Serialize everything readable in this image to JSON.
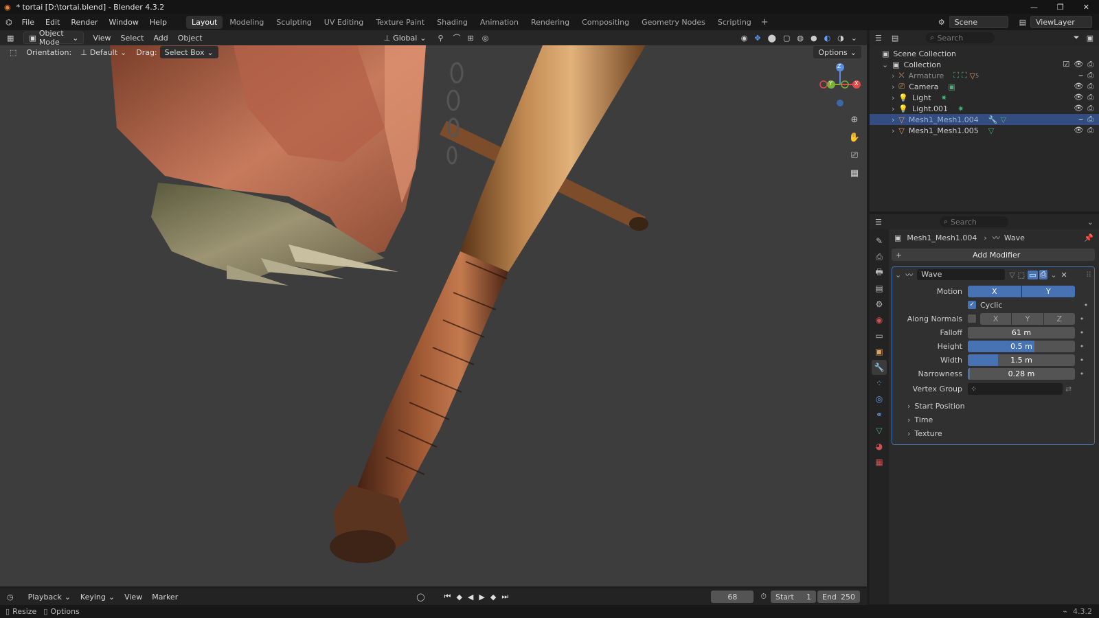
{
  "window": {
    "title": "* tortai [D:\\tortai.blend] - Blender 4.3.2",
    "min_icon": "minimize-icon",
    "max_icon": "maximize-icon",
    "close_icon": "close-icon"
  },
  "menu": [
    "File",
    "Edit",
    "Render",
    "Window",
    "Help"
  ],
  "workspaces": [
    "Layout",
    "Modeling",
    "Sculpting",
    "UV Editing",
    "Texture Paint",
    "Shading",
    "Animation",
    "Rendering",
    "Compositing",
    "Geometry Nodes",
    "Scripting"
  ],
  "active_workspace": "Layout",
  "scene": {
    "label": "Scene",
    "view_layer": "ViewLayer"
  },
  "viewport": {
    "mode": "Object Mode",
    "view": "View",
    "select": "Select",
    "add": "Add",
    "object": "Object",
    "transform": "Global",
    "orientation_label": "Orientation:",
    "orientation_value": "Default",
    "drag_label": "Drag:",
    "drag_value": "Select Box",
    "options": "Options",
    "axes": {
      "x": "X",
      "y": "Y",
      "z": "Z"
    }
  },
  "outliner": {
    "search_placeholder": "Search",
    "scene_collection": "Scene Collection",
    "collection": "Collection",
    "items": [
      {
        "name": "Armature",
        "extra": "5",
        "dim": true
      },
      {
        "name": "Camera",
        "dim": false
      },
      {
        "name": "Light",
        "dim": false
      },
      {
        "name": "Light.001",
        "dim": false
      },
      {
        "name": "Mesh1_Mesh1.004",
        "selected": true
      },
      {
        "name": "Mesh1_Mesh1.005",
        "dim": false
      }
    ]
  },
  "properties": {
    "search_placeholder": "Search",
    "breadcrumb_object": "Mesh1_Mesh1.004",
    "breadcrumb_modifier": "Wave",
    "add_modifier": "Add Modifier",
    "modifier_name": "Wave",
    "motion_label": "Motion",
    "motion_x": "X",
    "motion_y": "Y",
    "cyclic": "Cyclic",
    "along_normals": "Along Normals",
    "an_x": "X",
    "an_y": "Y",
    "an_z": "Z",
    "falloff_label": "Falloff",
    "falloff": "61 m",
    "height_label": "Height",
    "height": "0.5 m",
    "height_fill": 0.62,
    "width_label": "Width",
    "width": "1.5 m",
    "width_fill": 0.28,
    "narrowness_label": "Narrowness",
    "narrowness": "0.28 m",
    "narrowness_fill": 0.02,
    "vertex_group_label": "Vertex Group",
    "subpanels": [
      "Start Position",
      "Time",
      "Texture"
    ]
  },
  "timeline": {
    "playback": "Playback",
    "keying": "Keying",
    "view": "View",
    "marker": "Marker",
    "frame": "68",
    "start_label": "Start",
    "start": "1",
    "end_label": "End",
    "end": "250"
  },
  "status": {
    "resize": "Resize",
    "options": "Options",
    "version": "4.3.2"
  },
  "colors": {
    "accent": "#4772b3",
    "selected_row": "#334d80"
  }
}
